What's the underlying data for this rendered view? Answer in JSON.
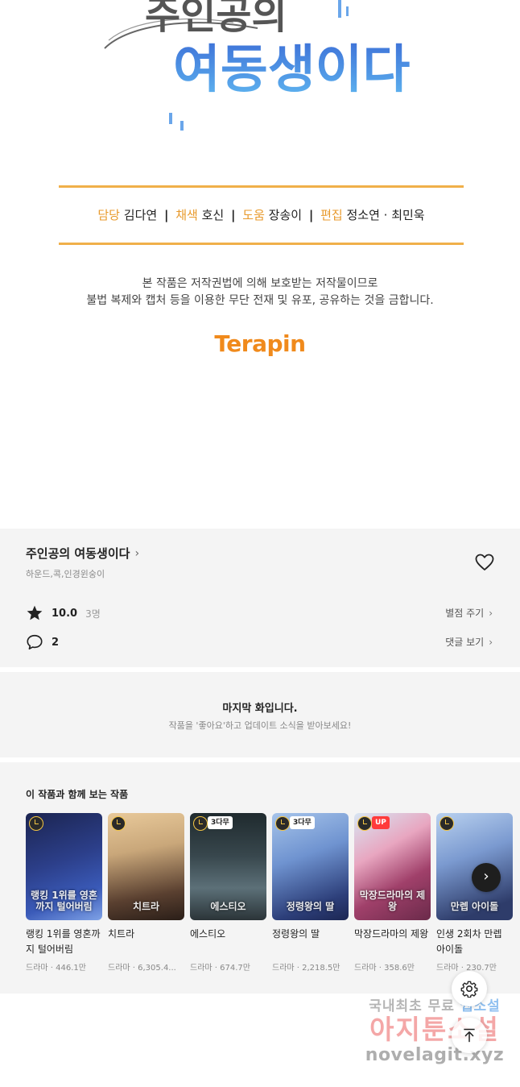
{
  "panel": {
    "logo_text_line1": "주인공의",
    "logo_text_line2": "여동생이다",
    "credits": [
      {
        "role": "담당",
        "name": "김다연"
      },
      {
        "role": "채색",
        "name": "호신"
      },
      {
        "role": "도움",
        "name": "장송이"
      },
      {
        "role": "편집",
        "name": "정소연 · 최민욱"
      }
    ],
    "credit_separator": "|",
    "notice_line1": "본 작품은 저작권법에 의해 보호받는 저작물이므로",
    "notice_line2": "불법 복제와 캡처 등을 이용한 무단 전재 및 유포, 공유하는 것을 금합니다.",
    "publisher": "Terapin"
  },
  "info": {
    "title": "주인공의 여동생이다",
    "authors": "하운드,콕,인경윈숭이",
    "rating": "10.0",
    "rating_count": "3명",
    "rate_action": "별점 주기",
    "comment_count": "2",
    "comment_action": "댓글 보기"
  },
  "last_episode": {
    "heading": "마지막 화입니다.",
    "subtext": "작품을 '좋아요'하고 업데이트 소식을 받아보세요!"
  },
  "recommendations": {
    "title": "이 작품과 함께 보는 작품",
    "items": [
      {
        "title": "랭킹 1위를 영혼까지 털어버림",
        "meta": "드라마 · 446.1만",
        "tag": "",
        "cover_text": "랭킹 1위를 영혼까지 털어버림",
        "palette": [
          "#1b2450",
          "#3a5ab8"
        ]
      },
      {
        "title": "치트라",
        "meta": "드라마 · 6,305.4...",
        "tag": "",
        "cover_text": "치트라",
        "palette": [
          "#5a4030",
          "#c9a77a"
        ]
      },
      {
        "title": "에스티오",
        "meta": "드라마 · 674.7만",
        "tag": "3다무",
        "cover_text": "에스티오",
        "palette": [
          "#1f2a2e",
          "#5c7078"
        ]
      },
      {
        "title": "정령왕의 딸",
        "meta": "드라마 · 2,218.5만",
        "tag": "3다무",
        "cover_text": "정령왕의 딸",
        "palette": [
          "#2d3f7a",
          "#a6c4ea"
        ]
      },
      {
        "title": "막장드라마의 제왕",
        "meta": "드라마 · 358.6만",
        "tag": "UP",
        "cover_text": "막장드라마의 제왕",
        "palette": [
          "#6a2a4a",
          "#d7e6f3"
        ]
      },
      {
        "title": "인생 2회차 만렙 아이돌",
        "meta": "드라마 · 230.7만",
        "tag": "",
        "cover_text": "만렙 아이돌",
        "palette": [
          "#2e3c6a",
          "#b9d1ef"
        ]
      }
    ]
  },
  "watermark": {
    "line1_a": "국내최초 무료 ",
    "line1_b": "웹소설",
    "line2": "아지툰소설",
    "line3": "novelagit.xyz"
  },
  "icons": {
    "heart": "heart-icon",
    "star": "star-icon",
    "comment": "comment-icon",
    "chevron": "chevron-right-icon",
    "settings": "gear-icon",
    "top": "arrow-up-icon"
  },
  "colors": {
    "accent_orange": "#e89a2c",
    "publisher_orange": "#f08a1c",
    "card_background": "#f4f4f4"
  }
}
